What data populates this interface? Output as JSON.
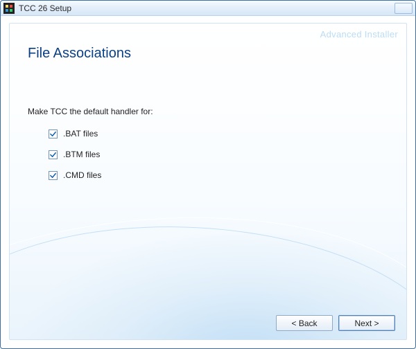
{
  "window": {
    "title": "TCC 26 Setup"
  },
  "brand": "Advanced Installer",
  "page": {
    "title": "File Associations",
    "prompt": "Make TCC  the default handler for:"
  },
  "options": [
    {
      "label": ".BAT files",
      "checked": true
    },
    {
      "label": ".BTM files",
      "checked": true
    },
    {
      "label": ".CMD files",
      "checked": true
    }
  ],
  "buttons": {
    "back": "< Back",
    "next": "Next >"
  }
}
